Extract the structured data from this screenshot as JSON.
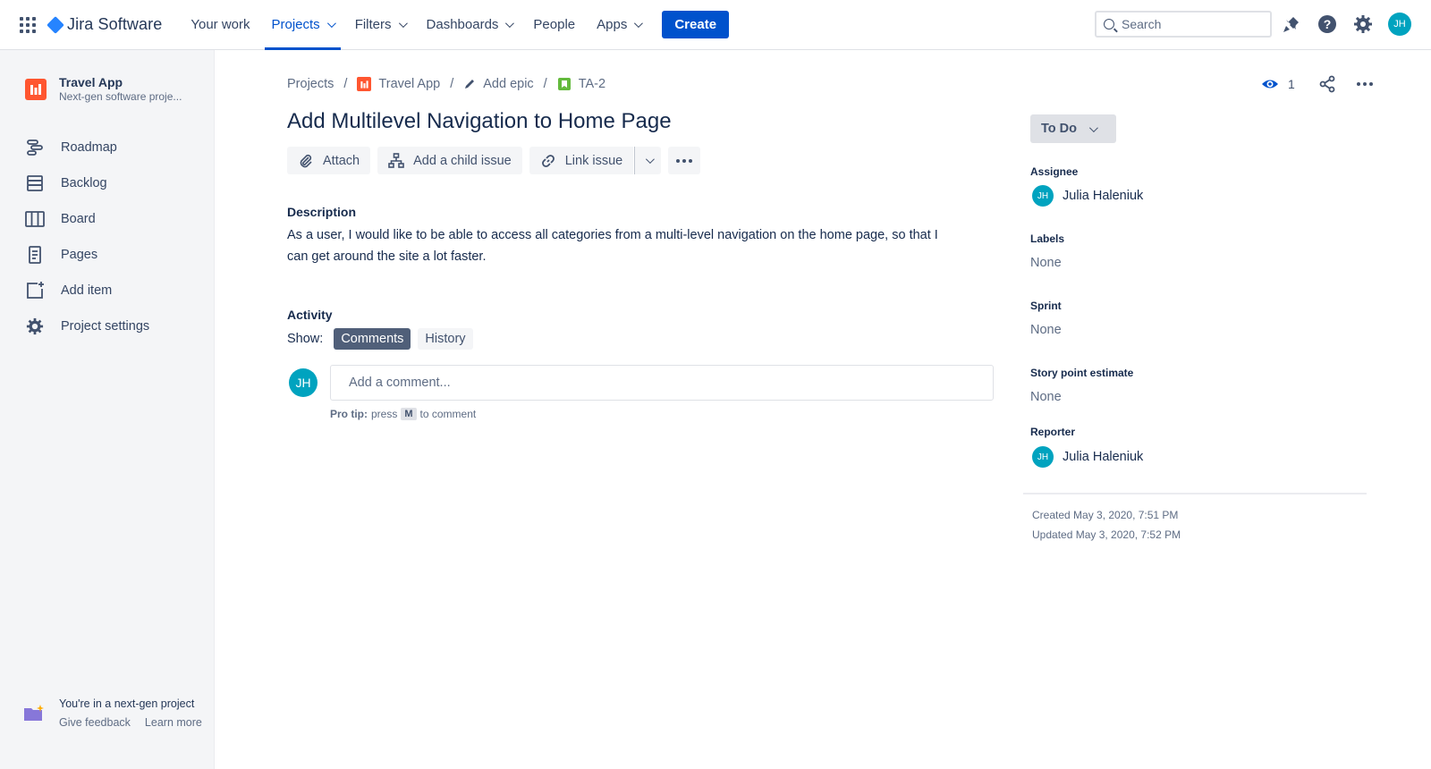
{
  "topnav": {
    "brand": "Jira Software",
    "items": [
      {
        "label": "Your work",
        "dropdown": false,
        "active": false
      },
      {
        "label": "Projects",
        "dropdown": true,
        "active": true
      },
      {
        "label": "Filters",
        "dropdown": true,
        "active": false
      },
      {
        "label": "Dashboards",
        "dropdown": true,
        "active": false
      },
      {
        "label": "People",
        "dropdown": false,
        "active": false
      },
      {
        "label": "Apps",
        "dropdown": true,
        "active": false
      }
    ],
    "create_label": "Create",
    "search_placeholder": "Search",
    "user_initials": "JH",
    "accent": "#0052cc"
  },
  "sidebar": {
    "project_name": "Travel App",
    "project_type": "Next-gen software proje...",
    "items": [
      {
        "label": "Roadmap",
        "icon": "roadmap-icon"
      },
      {
        "label": "Backlog",
        "icon": "backlog-icon"
      },
      {
        "label": "Board",
        "icon": "board-icon"
      },
      {
        "label": "Pages",
        "icon": "pages-icon"
      },
      {
        "label": "Add item",
        "icon": "add-item-icon"
      },
      {
        "label": "Project settings",
        "icon": "gear-icon"
      }
    ],
    "footer": {
      "title": "You're in a next-gen project",
      "feedback": "Give feedback",
      "learn": "Learn more"
    }
  },
  "breadcrumb": {
    "projects": "Projects",
    "project": "Travel App",
    "epic": "Add epic",
    "issue_key": "TA-2"
  },
  "issue": {
    "title": "Add Multilevel Navigation to Home Page",
    "toolbar": {
      "attach": "Attach",
      "child": "Add a child issue",
      "link": "Link issue"
    },
    "description_label": "Description",
    "description": "As a user, I would like to be able to access all categories from a multi-level navigation on the home page, so that I can get around the site a lot faster.",
    "activity_label": "Activity",
    "show_label": "Show:",
    "tabs": {
      "comments": "Comments",
      "history": "History"
    },
    "comment_placeholder": "Add a comment...",
    "protip": {
      "prefix": "Pro tip:",
      "press": "press",
      "key": "M",
      "suffix": "to comment"
    }
  },
  "details": {
    "watchers": "1",
    "status": "To Do",
    "assignee_label": "Assignee",
    "assignee": "Julia Haleniuk",
    "labels_label": "Labels",
    "labels_value": "None",
    "sprint_label": "Sprint",
    "sprint_value": "None",
    "story_label": "Story point estimate",
    "story_value": "None",
    "reporter_label": "Reporter",
    "reporter": "Julia Haleniuk",
    "created": "Created May 3, 2020, 7:51 PM",
    "updated": "Updated May 3, 2020, 7:52 PM"
  }
}
